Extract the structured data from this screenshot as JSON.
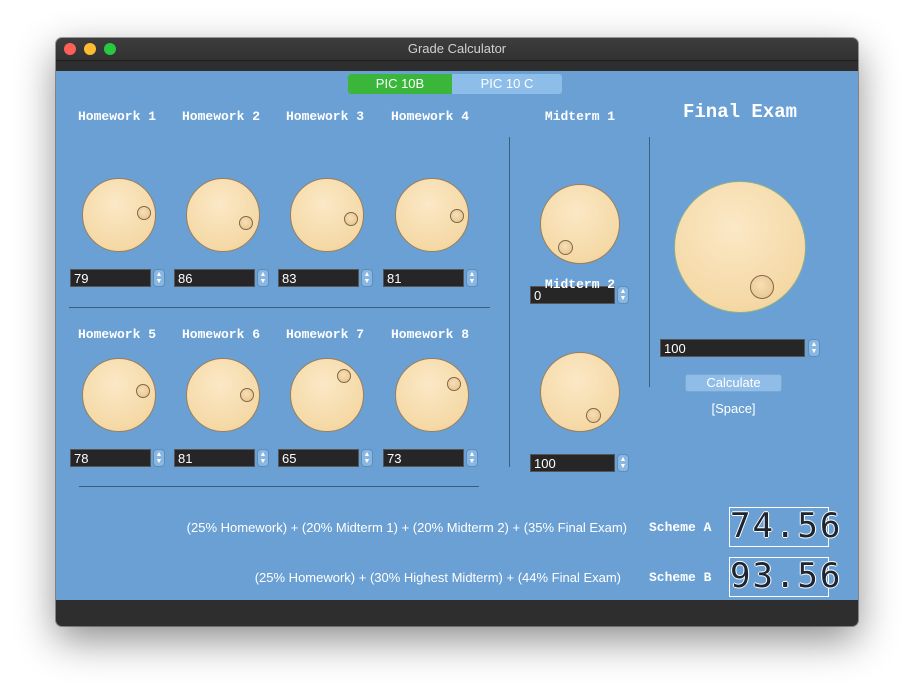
{
  "window": {
    "title": "Grade Calculator"
  },
  "tabs": [
    {
      "label": "PIC 10B",
      "active": true
    },
    {
      "label": "PIC 10 C",
      "active": false
    }
  ],
  "homework": [
    {
      "label": "Homework 1",
      "value": "79"
    },
    {
      "label": "Homework 2",
      "value": "86"
    },
    {
      "label": "Homework 3",
      "value": "83"
    },
    {
      "label": "Homework 4",
      "value": "81"
    },
    {
      "label": "Homework 5",
      "value": "78"
    },
    {
      "label": "Homework 6",
      "value": "81"
    },
    {
      "label": "Homework 7",
      "value": "65"
    },
    {
      "label": "Homework 8",
      "value": "73"
    }
  ],
  "midterms": [
    {
      "label": "Midterm 1",
      "value": "0"
    },
    {
      "label": "Midterm 2",
      "value": "100"
    }
  ],
  "final_exam": {
    "label": "Final Exam",
    "value": "100"
  },
  "calculate": {
    "label": "Calculate",
    "hint": "[Space]"
  },
  "schemes": [
    {
      "formula": "(25% Homework) + (20% Midterm 1) + (20% Midterm 2) + (35% Final Exam)",
      "label": "Scheme A",
      "result": "74.56"
    },
    {
      "formula": "(25% Homework) + (30% Highest Midterm) + (44% Final Exam)",
      "label": "Scheme B",
      "result": "93.56"
    }
  ],
  "colors": {
    "background": "#6aa0d4",
    "tab_active": "#3ab73a",
    "tab_inactive": "#8dbde9",
    "knob": "#f5d9a6"
  }
}
